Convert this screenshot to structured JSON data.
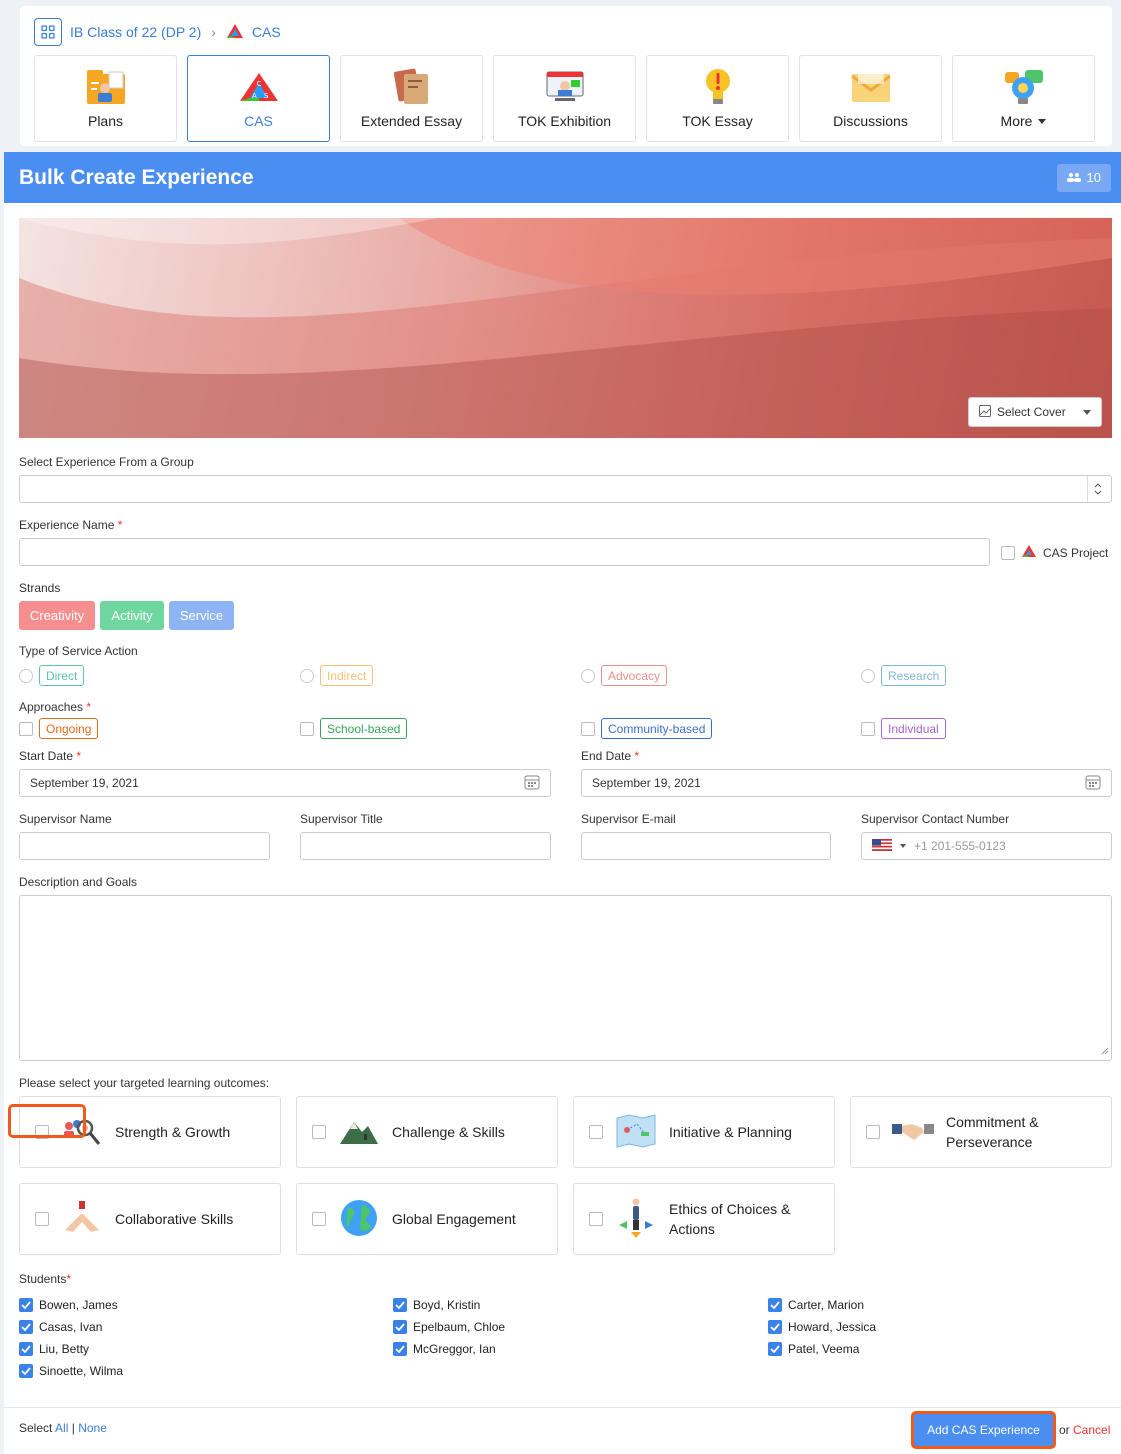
{
  "breadcrumb": {
    "class_name": "IB Class of 22 (DP 2)",
    "section": "CAS"
  },
  "tabs": [
    {
      "label": "Plans",
      "icon": "plans-icon"
    },
    {
      "label": "CAS",
      "icon": "cas-icon",
      "active": true
    },
    {
      "label": "Extended Essay",
      "icon": "books-icon"
    },
    {
      "label": "TOK Exhibition",
      "icon": "presentation-icon"
    },
    {
      "label": "TOK Essay",
      "icon": "lightbulb-icon"
    },
    {
      "label": "Discussions",
      "icon": "envelope-icon"
    },
    {
      "label": "More",
      "icon": "chat-bulb-icon"
    }
  ],
  "header": {
    "title": "Bulk Create Experience",
    "count": "10"
  },
  "cover": {
    "select_label": "Select Cover"
  },
  "form": {
    "group_label": "Select Experience From a Group",
    "name_label": "Experience Name",
    "cas_project_label": "CAS Project",
    "strands_label": "Strands",
    "strands": [
      {
        "label": "Creativity",
        "color": "#f58f8f"
      },
      {
        "label": "Activity",
        "color": "#6fd6a0"
      },
      {
        "label": "Service",
        "color": "#8fb4f5"
      }
    ],
    "service_label": "Type of Service Action",
    "service": [
      {
        "label": "Direct",
        "color": "#5cc7a8"
      },
      {
        "label": "Indirect",
        "color": "#f5c07a"
      },
      {
        "label": "Advocacy",
        "color": "#e8908a"
      },
      {
        "label": "Research",
        "color": "#7fb7d8"
      }
    ],
    "approaches_label": "Approaches",
    "approaches": [
      {
        "label": "Ongoing",
        "color": "#e36b1a"
      },
      {
        "label": "School-based",
        "color": "#3aa55a"
      },
      {
        "label": "Community-based",
        "color": "#3a6fc8"
      },
      {
        "label": "Individual",
        "color": "#a866c8"
      }
    ],
    "start_label": "Start Date",
    "start_value": "September 19, 2021",
    "end_label": "End Date",
    "end_value": "September 19, 2021",
    "sup_name_label": "Supervisor Name",
    "sup_title_label": "Supervisor Title",
    "sup_email_label": "Supervisor E-mail",
    "sup_phone_label": "Supervisor Contact Number",
    "sup_phone_placeholder": "+1 201-555-0123",
    "desc_label": "Description and Goals",
    "outcomes_label": "Please select your targeted learning outcomes:",
    "outcomes": [
      {
        "l1": "Strength & Growth",
        "l2": ""
      },
      {
        "l1": "Challenge & Skills",
        "l2": ""
      },
      {
        "l1": "Initiative & Planning",
        "l2": ""
      },
      {
        "l1": "Commitment &",
        "l2": "Perseverance"
      },
      {
        "l1": "Collaborative Skills",
        "l2": ""
      },
      {
        "l1": "Global Engagement",
        "l2": ""
      },
      {
        "l1": "Ethics of Choices &",
        "l2": "Actions"
      }
    ],
    "students_label": "Students",
    "students": [
      "Bowen, James",
      "Boyd, Kristin",
      "Carter, Marion",
      "Casas, Ivan",
      "Epelbaum, Chloe",
      "Howard, Jessica",
      "Liu, Betty",
      "McGreggor, Ian",
      "Patel, Veema",
      "Sinoette, Wilma"
    ]
  },
  "footer": {
    "select_text": "Select",
    "all": "All",
    "divider": "|",
    "none": "None",
    "add_button": "Add CAS Experience",
    "or": "or",
    "cancel": "Cancel"
  }
}
